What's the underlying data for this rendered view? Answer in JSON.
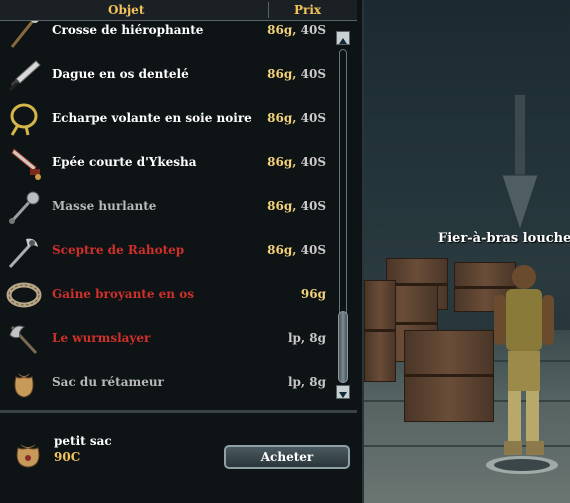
{
  "merchant": {
    "columns": {
      "object": "Objet",
      "price": "Prix"
    },
    "items": [
      {
        "name": "Crosse de hiérophante",
        "gold": "86g,",
        "silver": "40S",
        "name_color": "#ffffff",
        "icon": "staff-icon"
      },
      {
        "name": "Dague en os dentelé",
        "gold": "86g,",
        "silver": "40S",
        "name_color": "#ffffff",
        "icon": "dagger-icon"
      },
      {
        "name": "Echarpe volante en soie noire",
        "gold": "86g,",
        "silver": "40S",
        "name_color": "#ffffff",
        "icon": "sash-icon"
      },
      {
        "name": "Epée courte d'Ykesha",
        "gold": "86g,",
        "silver": "40S",
        "name_color": "#ffffff",
        "icon": "shortsword-icon"
      },
      {
        "name": "Masse hurlante",
        "gold": "86g,",
        "silver": "40S",
        "name_color": "#b8b8b8",
        "icon": "mace-icon"
      },
      {
        "name": "Sceptre de Rahotep",
        "gold": "86g,",
        "silver": "40S",
        "name_color": "#d0302a",
        "icon": "scepter-icon"
      },
      {
        "name": "Gaine broyante en os",
        "gold": "96g",
        "silver": "",
        "name_color": "#d0302a",
        "icon": "bracelet-icon"
      },
      {
        "name": "Le wurmslayer",
        "gold": "",
        "silver": "lp, 8g",
        "name_color": "#d0302a",
        "icon": "axe-icon"
      },
      {
        "name": "Sac du rétameur",
        "gold": "",
        "silver": "lp, 8g",
        "name_color": "#b8b8b8",
        "icon": "bag-icon"
      }
    ],
    "selected": {
      "name": "petit sac",
      "price": "90C",
      "icon": "small-bag-icon"
    },
    "buy_label": "Acheter"
  },
  "world": {
    "npc_name": "Fier-à-bras louche X"
  }
}
